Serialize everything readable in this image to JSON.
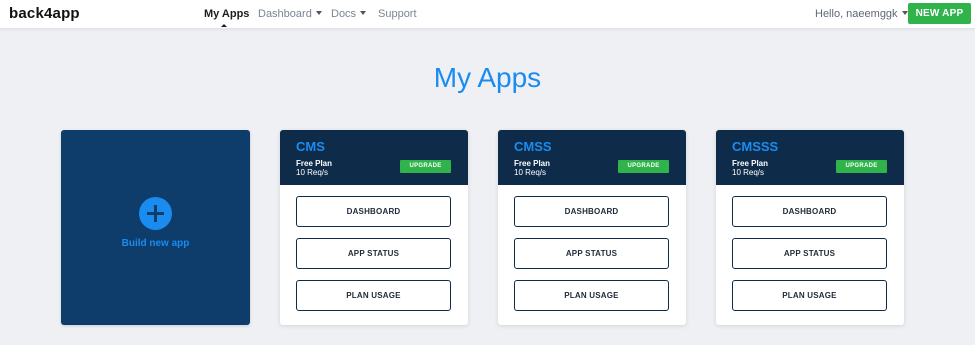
{
  "header": {
    "logo": "back4app",
    "nav": [
      {
        "label": "My Apps",
        "active": true,
        "dropdown": false
      },
      {
        "label": "Dashboard",
        "active": false,
        "dropdown": true
      },
      {
        "label": "Docs",
        "active": false,
        "dropdown": true
      },
      {
        "label": "Support",
        "active": false,
        "dropdown": false
      }
    ],
    "greeting": "Hello, naeemggk",
    "new_app_label": "NEW APP"
  },
  "page": {
    "title": "My Apps"
  },
  "build_tile": {
    "icon": "plus-circle-icon",
    "label": "Build new app"
  },
  "apps": [
    {
      "name": "CMS",
      "plan": "Free Plan",
      "requests": "10 Req/s",
      "upgrade_label": "UPGRADE",
      "buttons": [
        "DASHBOARD",
        "APP STATUS",
        "PLAN USAGE"
      ]
    },
    {
      "name": "CMSS",
      "plan": "Free Plan",
      "requests": "10 Req/s",
      "upgrade_label": "UPGRADE",
      "buttons": [
        "DASHBOARD",
        "APP STATUS",
        "PLAN USAGE"
      ]
    },
    {
      "name": "CMSSS",
      "plan": "Free Plan",
      "requests": "10 Req/s",
      "upgrade_label": "UPGRADE",
      "buttons": [
        "DASHBOARD",
        "APP STATUS",
        "PLAN USAGE"
      ]
    }
  ],
  "colors": {
    "accent_blue": "#1a8cf0",
    "card_header": "#0e2c4a",
    "build_tile": "#0e3c6b",
    "green": "#2fb34a",
    "background": "#eef0f4"
  }
}
